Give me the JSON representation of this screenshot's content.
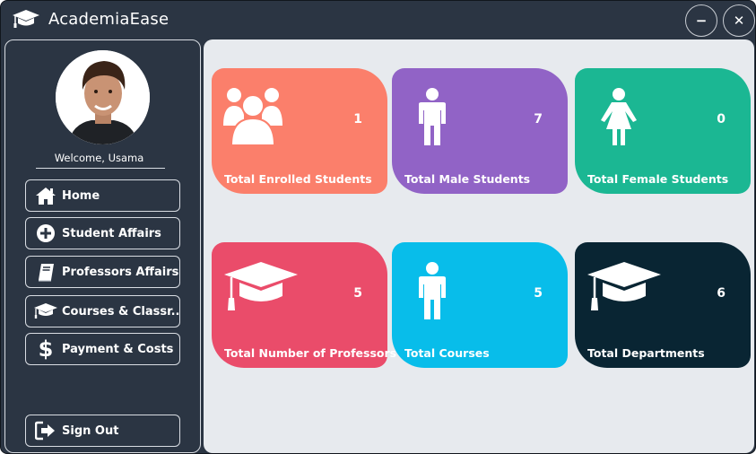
{
  "app": {
    "title": "AcademiaEase",
    "logo_icon": "graduation-cap-icon"
  },
  "window_controls": {
    "minimize": "−",
    "close": "✕"
  },
  "sidebar": {
    "welcome": "Welcome, Usama",
    "avatar_icon": "user-avatar",
    "items": [
      {
        "label": "Home",
        "icon": "home-icon"
      },
      {
        "label": "Student Affairs",
        "icon": "plus-circle-icon"
      },
      {
        "label": "Professors Affairs",
        "icon": "book-icon"
      },
      {
        "label": "Courses & Classr...",
        "icon": "graduation-cap-icon"
      },
      {
        "label": "Payment & Costs",
        "icon": "dollar-icon"
      }
    ],
    "sign_out": {
      "label": "Sign Out",
      "icon": "sign-out-icon"
    }
  },
  "cards": [
    {
      "label": "Total Enrolled Students",
      "value": "1",
      "icon": "group-icon",
      "color": "#fb7f6b"
    },
    {
      "label": "Total Male Students",
      "value": "7",
      "icon": "male-icon",
      "color": "#9163c6"
    },
    {
      "label": "Total Female Students",
      "value": "0",
      "icon": "female-icon",
      "color": "#1bb793"
    },
    {
      "label": "Total Number of Professors",
      "value": "5",
      "icon": "graduation-cap-icon",
      "color": "#ea4c6a"
    },
    {
      "label": "Total Courses",
      "value": "5",
      "icon": "person-icon",
      "color": "#08bdea"
    },
    {
      "label": "Total Departments",
      "value": "6",
      "icon": "graduation-cap-icon",
      "color": "#092533"
    }
  ]
}
